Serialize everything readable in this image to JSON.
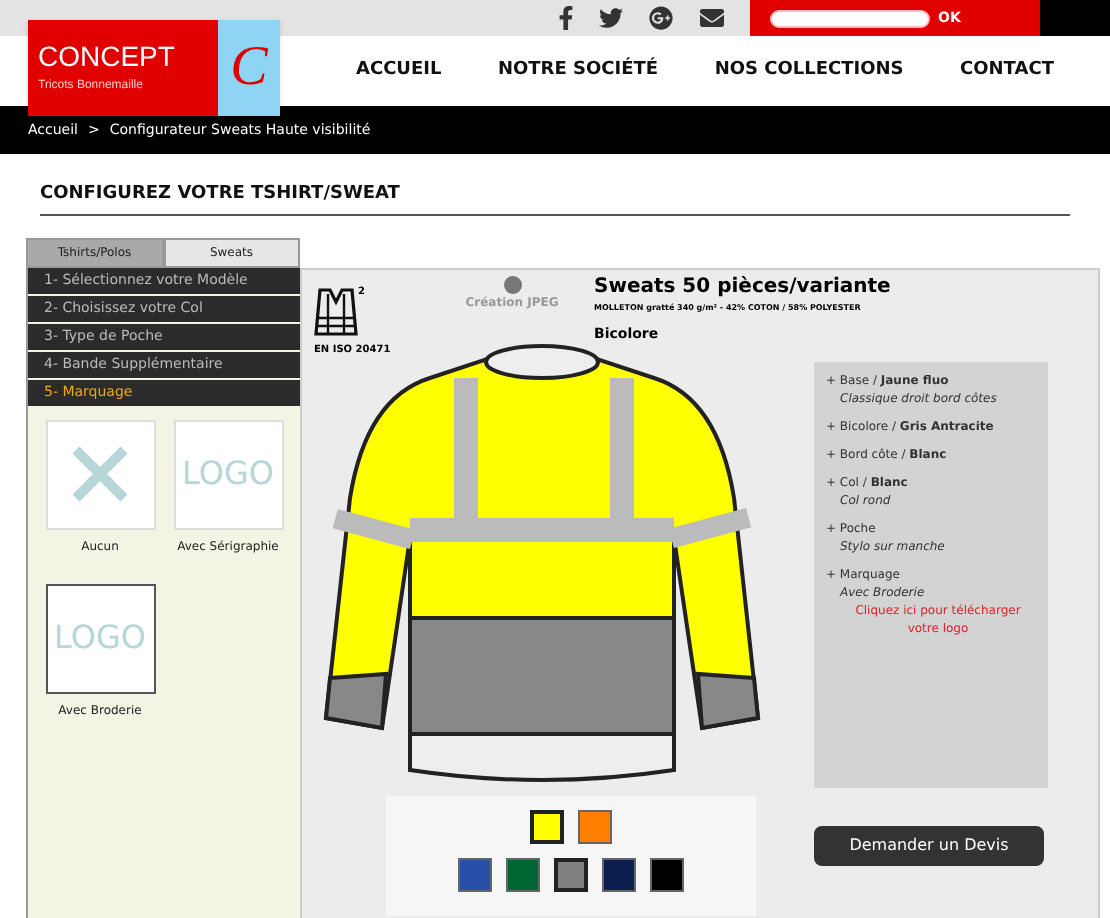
{
  "logo": {
    "name": "CONCEPT",
    "letter": "C",
    "tagline": "Tricots Bonnemaille"
  },
  "search": {
    "button": "OK"
  },
  "nav": [
    "ACCUEIL",
    "NOTRE SOCIÉTÉ",
    "NOS COLLECTIONS",
    "CONTACT"
  ],
  "breadcrumb": [
    "Accueil",
    "Configurateur Sweats Haute visibilité"
  ],
  "breadcrumb_separator": ">",
  "page_title": "CONFIGUREZ VOTRE TSHIRT/SWEAT",
  "tabs": [
    {
      "label": "Tshirts/Polos",
      "selected": false
    },
    {
      "label": "Sweats",
      "selected": true
    }
  ],
  "steps": [
    {
      "label": "1- Sélectionnez votre Modèle",
      "selected": false
    },
    {
      "label": "2- Choisissez votre Col",
      "selected": false
    },
    {
      "label": "3- Type de Poche",
      "selected": false
    },
    {
      "label": "4- Bande Supplémentaire",
      "selected": false
    },
    {
      "label": "5- Marquage",
      "selected": true
    }
  ],
  "marking_options": [
    {
      "kind": "none",
      "label": "Aucun",
      "selected": false
    },
    {
      "kind": "logo",
      "label": "Avec Sérigraphie",
      "selected": false,
      "logo": "LOGO"
    },
    {
      "kind": "logo",
      "label": "Avec Broderie",
      "selected": true,
      "logo": "LOGO"
    }
  ],
  "norm": {
    "class": "2",
    "label": "EN ISO 20471"
  },
  "creation": "Création JPEG",
  "product": {
    "title": "Sweats 50 pièces/variante",
    "subtitle": "MOLLETON gratté 340 g/m² - 42% COTON / 58% POLYESTER",
    "variant": "Bicolore"
  },
  "specs": [
    {
      "line": "+ Base / **Jaune fluo**",
      "detail": "Classique droit bord côtes"
    },
    {
      "line": "+ Bicolore / **Gris Antracite**"
    },
    {
      "line": "+ Bord côte / **Blanc**"
    },
    {
      "line": "+ Col / **Blanc**",
      "detail": "Col rond"
    },
    {
      "line": "+ Poche",
      "detail": "Stylo sur manche"
    },
    {
      "line": "+ Marquage",
      "detail": "Avec Broderie",
      "link": "Cliquez ici pour télécharger votre logo"
    }
  ],
  "swatch_rows": [
    [
      {
        "color": "#ffff00",
        "selected": true
      },
      {
        "color": "#ff7f00",
        "selected": false
      }
    ],
    [
      {
        "color": "#2a4fa8",
        "selected": false
      },
      {
        "color": "#006633",
        "selected": false
      },
      {
        "color": "#808080",
        "selected": true
      },
      {
        "color": "#0d1f4f",
        "selected": false
      },
      {
        "color": "#000000",
        "selected": false
      }
    ]
  ],
  "quote_button": "Demander un Devis"
}
